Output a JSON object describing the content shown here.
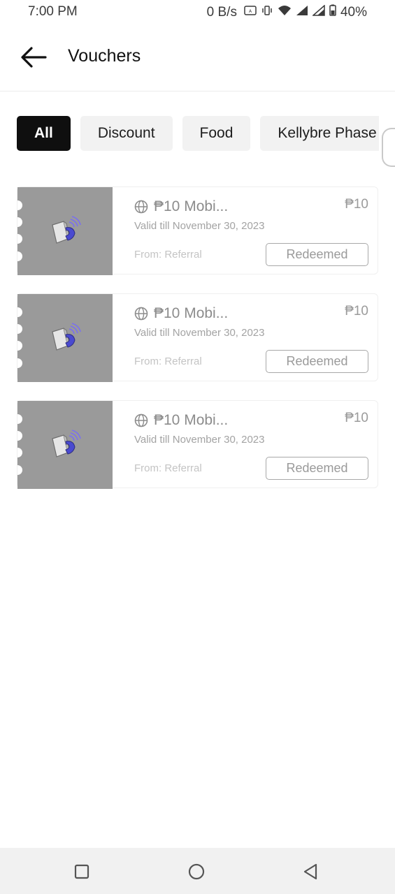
{
  "status_bar": {
    "time": "7:00 PM",
    "net_speed": "0 B/s",
    "battery": "40%",
    "icons": [
      "auto-icon",
      "vibrate-icon",
      "wifi-icon",
      "signal-icon",
      "signal-icon",
      "battery-icon"
    ]
  },
  "header": {
    "title": "Vouchers",
    "back_icon": "arrow-left-icon"
  },
  "filters": {
    "chips": [
      {
        "label": "All",
        "active": true
      },
      {
        "label": "Discount",
        "active": false
      },
      {
        "label": "Food",
        "active": false
      },
      {
        "label": "Kellybre Phase",
        "active": false
      }
    ]
  },
  "vouchers": [
    {
      "icon": "globe-icon",
      "title": "₱10 Mobi...",
      "amount": "₱10",
      "valid": "Valid till November 30, 2023",
      "from": "From: Referral",
      "status": "Redeemed"
    },
    {
      "icon": "globe-icon",
      "title": "₱10 Mobi...",
      "amount": "₱10",
      "valid": "Valid till November 30, 2023",
      "from": "From: Referral",
      "status": "Redeemed"
    },
    {
      "icon": "globe-icon",
      "title": "₱10 Mobi...",
      "amount": "₱10",
      "valid": "Valid till November 30, 2023",
      "from": "From: Referral",
      "status": "Redeemed"
    }
  ],
  "nav_bar": {
    "icons": [
      "recents-square-icon",
      "home-circle-icon",
      "back-triangle-icon"
    ]
  },
  "colors": {
    "active_chip": "#0f0f0f",
    "chip_bg": "#f2f2f2",
    "voucher_image_bg": "#9a9a9a"
  }
}
